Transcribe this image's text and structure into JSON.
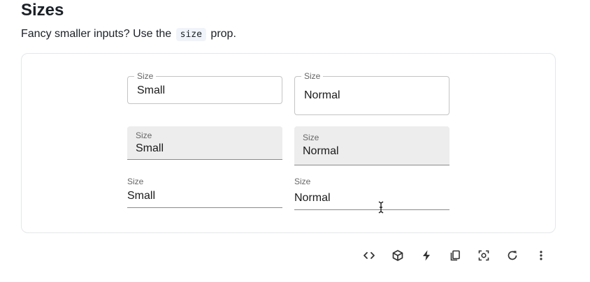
{
  "section": {
    "title": "Sizes",
    "desc_before": "Fancy smaller inputs? Use the",
    "desc_code": "size",
    "desc_after": "prop."
  },
  "fields": {
    "outlined_small": {
      "label": "Size",
      "value": "Small"
    },
    "outlined_normal": {
      "label": "Size",
      "value": "Normal"
    },
    "filled_small": {
      "label": "Size",
      "value": "Small"
    },
    "filled_normal": {
      "label": "Size",
      "value": "Normal"
    },
    "standard_small": {
      "label": "Size",
      "value": "Small"
    },
    "standard_normal": {
      "label": "Size",
      "value": "Normal"
    }
  },
  "toolbar": {
    "icons": [
      "code-icon",
      "cube-icon",
      "bolt-icon",
      "copy-icon",
      "screenshot-icon",
      "reload-icon",
      "more-vert-icon"
    ]
  }
}
